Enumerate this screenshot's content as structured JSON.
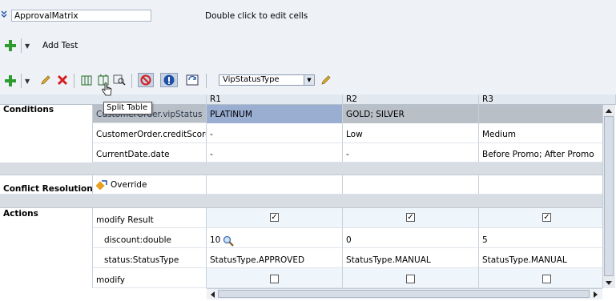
{
  "header": {
    "collapse_icon": "double-chevron-down-icon",
    "title_value": "ApprovalMatrix",
    "hint": "Double click to edit cells"
  },
  "toolbar1": {
    "add_test_label": "Add Test"
  },
  "toolbar2": {
    "tooltip": "Split Table",
    "vip_select": "VipStatusType"
  },
  "columns": [
    "R1",
    "R2",
    "R3"
  ],
  "sections": {
    "conditions": "Conditions",
    "conflict": "Conflict Resolution",
    "actions": "Actions"
  },
  "conditions": [
    {
      "label": "CustomerOrder.vipStatus",
      "r1": "PLATINUM",
      "r2": "GOLD; SILVER",
      "r3": ""
    },
    {
      "label": "CustomerOrder.creditScore",
      "r1": "-",
      "r2": "Low",
      "r3": "Medium"
    },
    {
      "label": "CurrentDate.date",
      "r1": "-",
      "r2": "-",
      "r3": "Before Promo; After Promo"
    }
  ],
  "conflict": {
    "label": "Override"
  },
  "actions": [
    {
      "label": "modify Result",
      "r1_checked": true,
      "r2_checked": true,
      "r3_checked": true
    },
    {
      "label": "discount:double",
      "r1": "10",
      "r2": "0",
      "r3": "5"
    },
    {
      "label": "status:StatusType",
      "r1": "StatusType.APPROVED",
      "r2": "StatusType.MANUAL",
      "r3": "StatusType.MANUAL"
    },
    {
      "label": "modify",
      "r1_checked": false,
      "r2_checked": false,
      "r3_checked": false
    }
  ],
  "colors": {
    "selected_cell": "#9aaed2",
    "highlight_row": "#b9bfc7",
    "header_bg": "#e2e8ef"
  }
}
